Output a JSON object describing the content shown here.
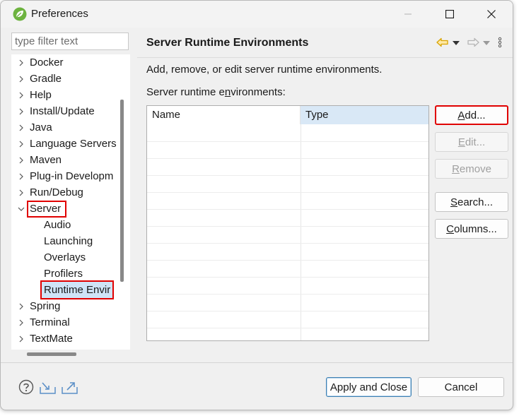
{
  "window": {
    "title": "Preferences"
  },
  "filter": {
    "placeholder": "type filter text"
  },
  "tree": {
    "items": [
      {
        "label": "Docker"
      },
      {
        "label": "Gradle"
      },
      {
        "label": "Help"
      },
      {
        "label": "Install/Update"
      },
      {
        "label": "Java"
      },
      {
        "label": "Language Servers"
      },
      {
        "label": "Maven"
      },
      {
        "label": "Plug-in Developm"
      },
      {
        "label": "Run/Debug"
      },
      {
        "label": "Server",
        "expanded": true,
        "highlighted": true
      },
      {
        "label": "Audio",
        "child": true
      },
      {
        "label": "Launching",
        "child": true
      },
      {
        "label": "Overlays",
        "child": true
      },
      {
        "label": "Profilers",
        "child": true
      },
      {
        "label": "Runtime Envir",
        "child": true,
        "selected": true,
        "highlighted": true
      },
      {
        "label": "Spring"
      },
      {
        "label": "Terminal"
      },
      {
        "label": "TextMate"
      }
    ]
  },
  "panel": {
    "title": "Server Runtime Environments",
    "description": "Add, remove, or edit server runtime environments.",
    "list_label_pre": "Server runtime e",
    "list_label_mnemonic": "n",
    "list_label_post": "vironments:",
    "columns": [
      "Name",
      "Type"
    ]
  },
  "buttons": {
    "add": {
      "mnemonic": "A",
      "rest": "dd...",
      "enabled": true,
      "highlighted": true
    },
    "edit": {
      "mnemonic": "E",
      "rest": "dit...",
      "enabled": false
    },
    "remove": {
      "mnemonic": "R",
      "rest": "emove",
      "enabled": false
    },
    "search": {
      "mnemonic": "S",
      "rest": "earch...",
      "enabled": true
    },
    "columns": {
      "mnemonic": "C",
      "rest": "olumns...",
      "enabled": true
    }
  },
  "footer": {
    "apply_close": "Apply and Close",
    "cancel": "Cancel"
  },
  "icons": {
    "app": "spring-leaf-icon",
    "minimize": "minimize-icon",
    "maximize": "maximize-icon",
    "close": "close-icon",
    "back": "back-arrow-icon",
    "forward": "forward-arrow-icon",
    "view_menu": "view-menu-icon",
    "help": "help-icon",
    "import": "import-icon",
    "export": "export-icon"
  },
  "colors": {
    "highlight": "#e00000",
    "selection": "#cfe4f7",
    "accent": "#3c7fb1",
    "back_arrow": "#d9a400"
  }
}
